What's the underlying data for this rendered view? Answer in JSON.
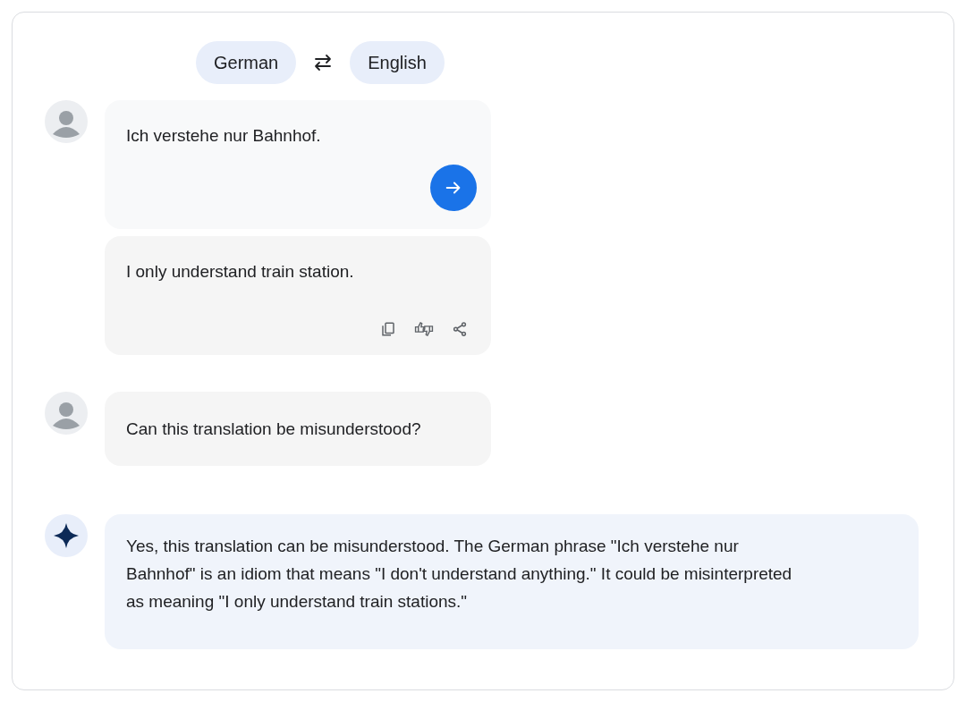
{
  "languages": [
    {
      "label": "German"
    },
    {
      "label": "English"
    }
  ],
  "messages": [
    {
      "kind": "source",
      "text": "Ich verstehe nur Bahnhof."
    },
    {
      "kind": "translation",
      "text": "I only understand train station."
    },
    {
      "kind": "question",
      "text": "Can this translation be misunderstood?"
    },
    {
      "kind": "answer",
      "text": "Yes, this translation can be misunderstood. The German phrase \"Ich verstehe nur Bahnhof\" is an idiom that means \"I don't understand anything.\" It could be misinterpreted as meaning \"I only understand train stations.\""
    }
  ]
}
